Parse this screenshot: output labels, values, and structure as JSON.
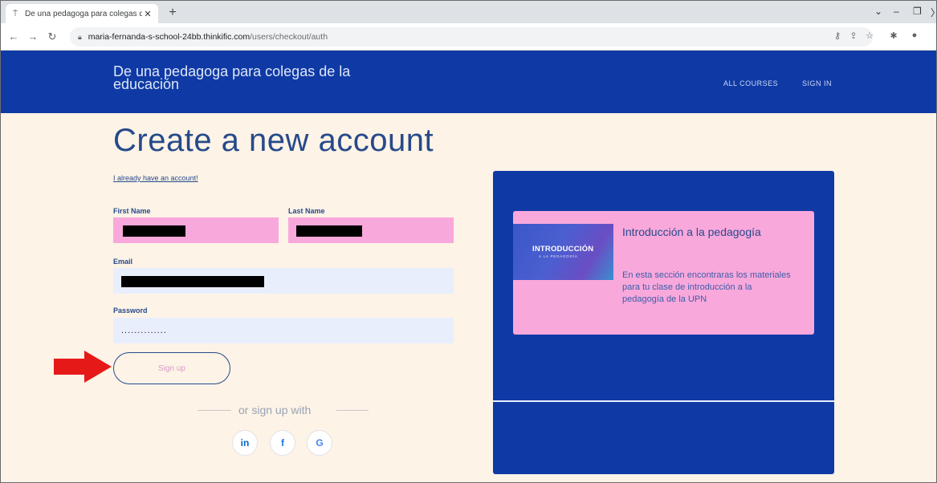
{
  "browser": {
    "tab_title": "De una pedagoga para colegas d",
    "tab_close": "✕",
    "new_tab": "+",
    "url_host": "maria-fernanda-s-school-24bb.thinkific.com",
    "url_path": "/users/checkout/auth",
    "icons": [
      "back-icon",
      "forward-icon",
      "reload-icon",
      "lock-icon",
      "key-icon",
      "share-icon",
      "star-icon",
      "extensions-icon",
      "profile-icon"
    ]
  },
  "site": {
    "brand": "De una pedagoga para colegas de la educación",
    "nav": [
      "ALL COURSES",
      "SIGN IN"
    ],
    "brand_color": "#0f3aa5"
  },
  "form": {
    "heading": "Create a new account",
    "already_link": "I already have an account!",
    "first_name_label": "First Name",
    "last_name_label": "Last Name",
    "email_label": "Email",
    "password_label": "Password",
    "password_value": "..............",
    "signup_label": "Sign up",
    "or_text": "or sign up with",
    "social": [
      {
        "name": "linkedin",
        "label": "in",
        "color": "#0a66c2"
      },
      {
        "name": "facebook",
        "label": "f",
        "color": "#1877f2"
      },
      {
        "name": "google",
        "label": "G",
        "color": "#4285f4"
      }
    ]
  },
  "course": {
    "thumb_title": "INTRODUCCIÓN",
    "thumb_subtitle": "A LA PEDAGOGÍA",
    "title": "Introducción a la pedagogía",
    "description": "En esta sección encontraras los materiales para tu clase de introducción a la pedagogía de la UPN"
  }
}
